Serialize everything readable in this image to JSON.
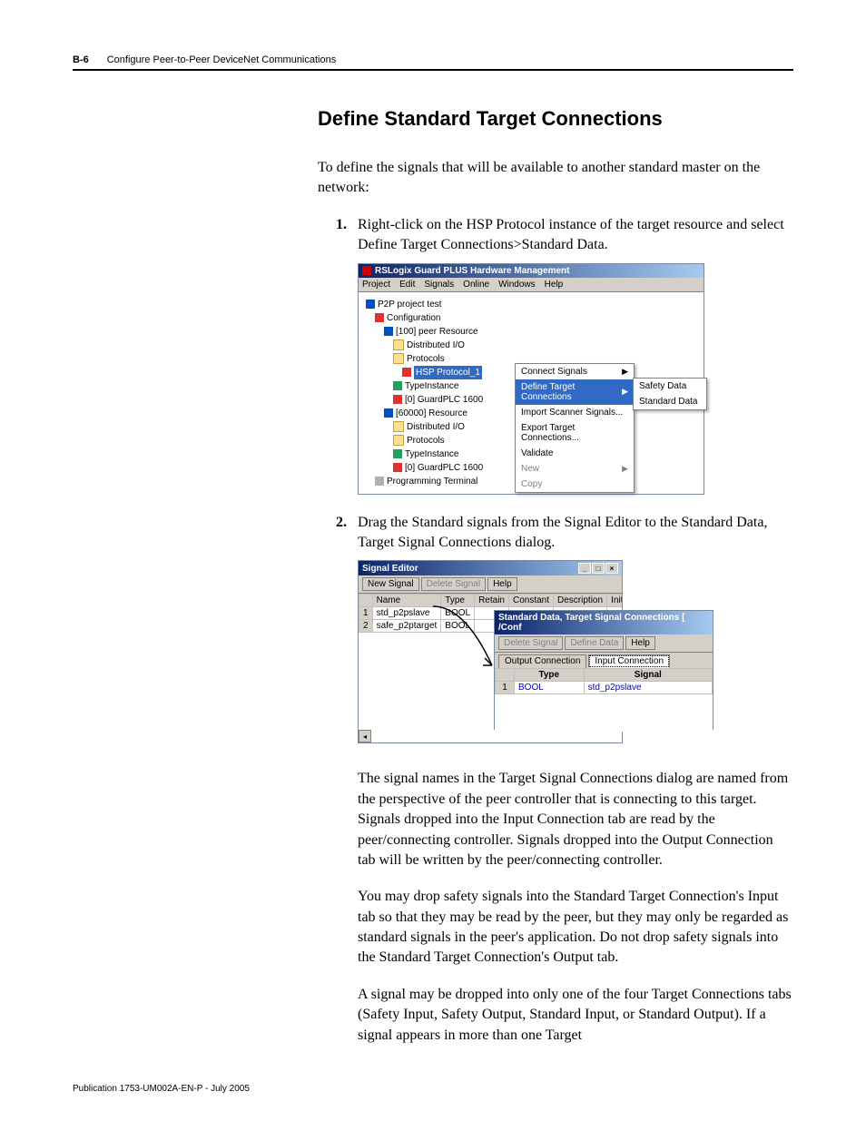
{
  "header": {
    "page_num": "B-6",
    "chapter": "Configure Peer-to-Peer DeviceNet Communications"
  },
  "section_title": "Define Standard Target Connections",
  "intro": "To define the signals that will be available to another standard master on the network:",
  "steps": {
    "s1num": "1.",
    "s1": "Right-click on the HSP Protocol instance of the target resource and select Define Target Connections>Standard Data.",
    "s2num": "2.",
    "s2": "Drag the Standard signals from the Signal Editor to the Standard Data, Target Signal Connections dialog."
  },
  "para1": "The signal names in the Target Signal Connections dialog are named from the perspective of the peer controller that is connecting to this target. Signals dropped into the Input Connection tab are read by the peer/connecting controller. Signals dropped into the Output Connection tab will be written by the peer/connecting controller.",
  "para2": "You may drop safety signals into the Standard Target Connection's Input tab so that they may be read by the peer, but they may only be regarded as standard signals in the peer's application. Do not drop safety signals into the Standard Target Connection's Output tab.",
  "para3": "A signal may be dropped into only one of the four Target Connections tabs (Safety Input, Safety Output, Standard Input, or Standard Output). If a signal appears in more than one Target",
  "footer": "Publication 1753-UM002A-EN-P - July 2005",
  "shot1": {
    "title": "RSLogix Guard PLUS Hardware Management",
    "menu": {
      "project": "Project",
      "edit": "Edit",
      "signals": "Signals",
      "online": "Online",
      "windows": "Windows",
      "help": "Help"
    },
    "tree": {
      "root": "P2P project test",
      "config": "Configuration",
      "res100": "[100] peer Resource",
      "dio": "Distributed I/O",
      "protocols": "Protocols",
      "hsp": "HSP Protocol_1",
      "typeinst": "TypeInstance",
      "guard0": "[0] GuardPLC 1600",
      "res60000": "[60000] Resource",
      "progterm": "Programming Terminal"
    },
    "ctx": {
      "connect": "Connect Signals",
      "define": "Define Target Connections",
      "import": "Import Scanner Signals...",
      "export": "Export Target Connections...",
      "validate": "Validate",
      "new": "New",
      "copy": "Copy"
    },
    "sub": {
      "safety": "Safety Data",
      "standard": "Standard Data"
    }
  },
  "shot2": {
    "sig_title": "Signal Editor",
    "newsig": "New Signal",
    "delsig": "Delete Signal",
    "help": "Help",
    "cols": {
      "name": "Name",
      "type": "Type",
      "retain": "Retain",
      "constant": "Constant",
      "description": "Description",
      "init": "Init.\\"
    },
    "row1": {
      "n": "1",
      "name": "std_p2pslave",
      "type": "BOOL"
    },
    "row2": {
      "n": "2",
      "name": "safe_p2ptarget",
      "type": "BOOL"
    },
    "tgt_title": "Standard Data, Target Signal Connections [ /Conf",
    "defdata": "Define Data",
    "tabs": {
      "out": "Output Connection",
      "in": "Input Connection"
    },
    "gcols": {
      "type": "Type",
      "signal": "Signal"
    },
    "grow": {
      "n": "1",
      "type": "BOOL",
      "sig": "std_p2pslave"
    }
  }
}
